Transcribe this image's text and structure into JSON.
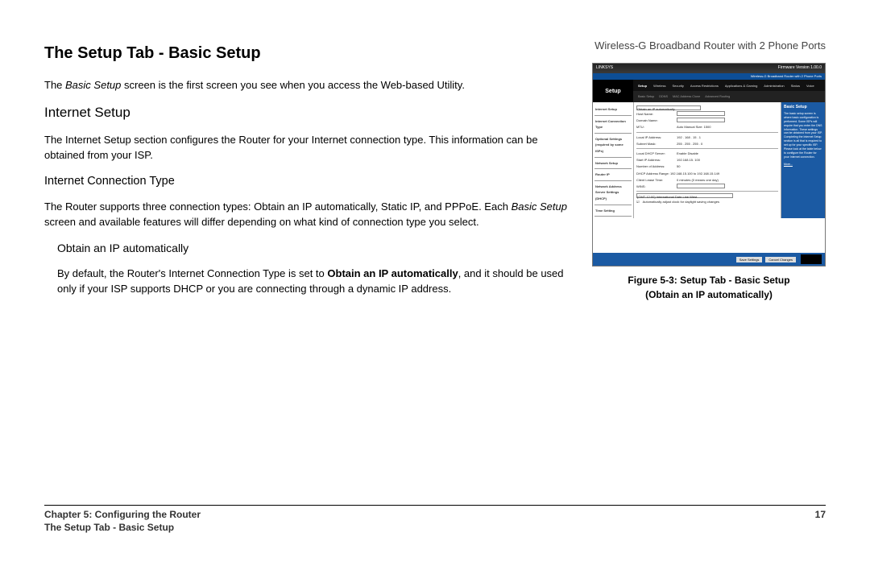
{
  "meta": {
    "product": "Wireless-G Broadband Router with 2 Phone Ports"
  },
  "heading": {
    "h1": "The Setup Tab - Basic Setup",
    "intro_pre": "The ",
    "intro_em": "Basic Setup",
    "intro_post": " screen is the first screen you see when you access the Web-based Utility.",
    "h2": "Internet Setup",
    "p2": "The Internet Setup section configures the Router for your Internet connection type. This information can be obtained from your ISP.",
    "h3": "Internet Connection Type",
    "p3_pre": "The Router supports three connection types: Obtain an IP automatically, Static IP, and PPPoE. Each ",
    "p3_em": "Basic Setup",
    "p3_post": " screen and available features will differ depending on what kind of connection type you select.",
    "h4": "Obtain an IP automatically",
    "p4_pre": "By default, the Router's Internet Connection Type is set to ",
    "p4_strong": "Obtain an IP automatically",
    "p4_post": ", and it should be used only if your ISP supports DHCP or you are connecting through a dynamic IP address."
  },
  "figure": {
    "caption_line1": "Figure 5-3: Setup Tab - Basic Setup",
    "caption_line2": "(Obtain an IP automatically)",
    "ui": {
      "brand": "LINKSYS",
      "bluebar": "Wireless-G Broadband Router with 2 Phone Ports",
      "section": "Setup",
      "tabs": [
        "Setup",
        "Wireless",
        "Security",
        "Access Restrictions",
        "Applications & Gaming",
        "Administration",
        "Status",
        "Voice"
      ],
      "subtabs": [
        "Basic Setup",
        "DDNS",
        "MAC Address Clone",
        "Advanced Routing"
      ],
      "leftcol": [
        "Internet Setup",
        "Internet Connection Type",
        "Optional Settings (required by some ISPs)",
        "Network Setup",
        "Router IP",
        "Network Address Server Settings (DHCP)",
        "Time Setting"
      ],
      "fields": {
        "conn_type": "Obtain an IP automatically",
        "hostname": "Host Name:",
        "domain": "Domain Name:",
        "mtu": "MTU:",
        "mtu_opts": "Auto  Manual  Size: 1500",
        "local_ip": "Local IP Address:",
        "local_ip_val": "192 . 168 . 15 . 1",
        "subnet": "Subnet Mask:",
        "subnet_val": "255 . 255 . 255 . 0",
        "dhcp": "Local DHCP Server:",
        "dhcp_opts": "Enable  Disable",
        "start_ip": "Start IP Address:",
        "start_ip_val": "192.168.15. 100",
        "num": "Number of Address:",
        "num_val": "50",
        "range": "DHCP Address Range: 192.168.15.100 to 192.168.15.149",
        "lease": "Client Lease Time:",
        "lease_val": "0  minutes (0 means one day)",
        "wins": "WINS:",
        "tz": "(GMT-12:00) International Date Line West",
        "tz_check": "Automatically adjust clock for daylight saving changes"
      },
      "right_title": "Basic Setup",
      "right_text": "The basic setup screen is where basic configuration is performed. Some ISPs will require that you enter the DNS information. These settings can be obtained from your ISP.\n\nCompleting the Internet Setup section is all that is required to set up for your specific ISP. Please look at the table below to configure the Router for your Internet connection.",
      "right_more": "More...",
      "buttons": {
        "save": "Save Settings",
        "cancel": "Cancel Changes"
      }
    }
  },
  "footer": {
    "chapter": "Chapter 5: Configuring the Router",
    "page": "17",
    "section": "The Setup Tab - Basic Setup"
  }
}
